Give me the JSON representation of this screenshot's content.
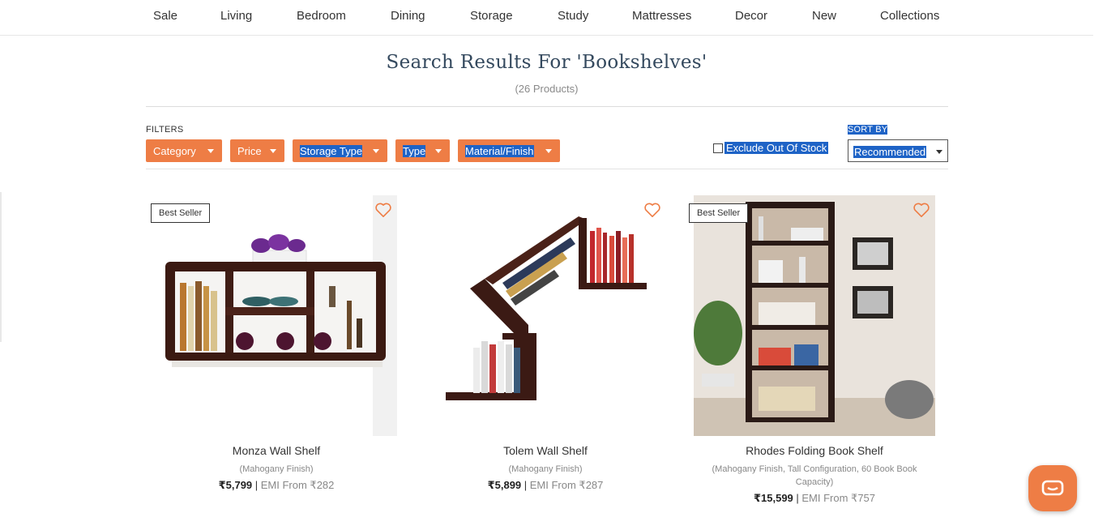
{
  "nav": [
    "Sale",
    "Living",
    "Bedroom",
    "Dining",
    "Storage",
    "Study",
    "Mattresses",
    "Decor",
    "New",
    "Collections"
  ],
  "search": {
    "title": "Search Results For 'Bookshelves'",
    "count": "(26 Products)"
  },
  "filters": {
    "label": "FILTERS",
    "buttons": [
      "Category",
      "Price",
      "Storage Type",
      "Type",
      "Material/Finish"
    ],
    "exclude_label": "Exclude Out Of Stock",
    "sort_label": "SORT BY",
    "sort_value": "Recommended"
  },
  "products": [
    {
      "badge": "Best Seller",
      "name": "Monza Wall Shelf",
      "finish": "(Mahogany Finish)",
      "price": "₹5,799",
      "emi": "EMI From ₹282"
    },
    {
      "badge": "",
      "name": "Tolem Wall Shelf",
      "finish": "(Mahogany Finish)",
      "price": "₹5,899",
      "emi": "EMI From ₹287"
    },
    {
      "badge": "Best Seller",
      "name": "Rhodes Folding Book Shelf",
      "finish": "(Mahogany Finish, Tall Configuration, 60 Book Book Capacity)",
      "price": "₹15,599",
      "emi": "EMI From ₹757"
    }
  ],
  "colors": {
    "accent": "#ee7d45",
    "title": "#34495e",
    "selection": "#1e63c6"
  },
  "icons": [
    "heart-icon",
    "caret-down-icon",
    "chat-icon"
  ]
}
